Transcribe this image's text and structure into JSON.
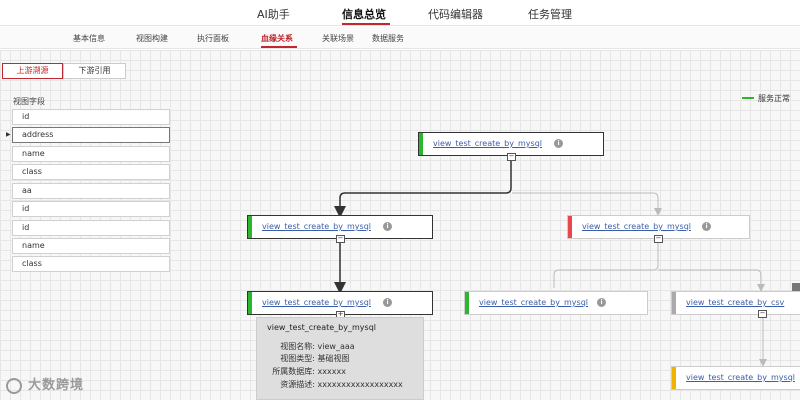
{
  "top_nav": {
    "tabs": [
      "AI助手",
      "信息总览",
      "代码编辑器",
      "任务管理"
    ],
    "active": "信息总览"
  },
  "sub_nav": {
    "tabs": [
      "基本信息",
      "视图构建",
      "执行面板",
      "血缘关系",
      "关联场景",
      "数据服务"
    ],
    "active": "血缘关系"
  },
  "direction_buttons": {
    "upstream": "上游溯源",
    "downstream": "下游引用",
    "active": "upstream"
  },
  "field_panel": {
    "title": "视图字段",
    "fields": [
      "id",
      "address",
      "name",
      "class",
      "aa",
      "id",
      "id",
      "name",
      "class"
    ],
    "selected_index": 1
  },
  "legend": {
    "label": "服务正常",
    "color": "#2db52d"
  },
  "nodes": [
    {
      "label": "view_test_create_by_mysql",
      "status_color": "#2db52d"
    },
    {
      "label": "view_test_create_by_mysql",
      "status_color": "#2db52d"
    },
    {
      "label": "view_test_create_by_mysql",
      "status_color": "#e8484b"
    },
    {
      "label": "view_test_create_by_mysql",
      "status_color": "#2db52d"
    },
    {
      "label": "view_test_create_by_mysql",
      "status_color": "#2db52d"
    },
    {
      "label": "view_test_create_by_csv",
      "status_color": "#aaaaaa"
    },
    {
      "label": "view_test_create_by_mysql",
      "status_color": "#f0b400"
    }
  ],
  "tooltip": {
    "title": "view_test_create_by_mysql",
    "rows": [
      {
        "key": "视图名称:",
        "value": "view_aaa"
      },
      {
        "key": "视图类型:",
        "value": "基础视图"
      },
      {
        "key": "所属数据库:",
        "value": "xxxxxx"
      },
      {
        "key": "资源描述:",
        "value": "xxxxxxxxxxxxxxxxxx"
      }
    ]
  },
  "watermark": "大数跨境",
  "colors": {
    "accent": "#c0282f",
    "edge_dark": "#333333",
    "edge_light": "#bbbbbb"
  }
}
